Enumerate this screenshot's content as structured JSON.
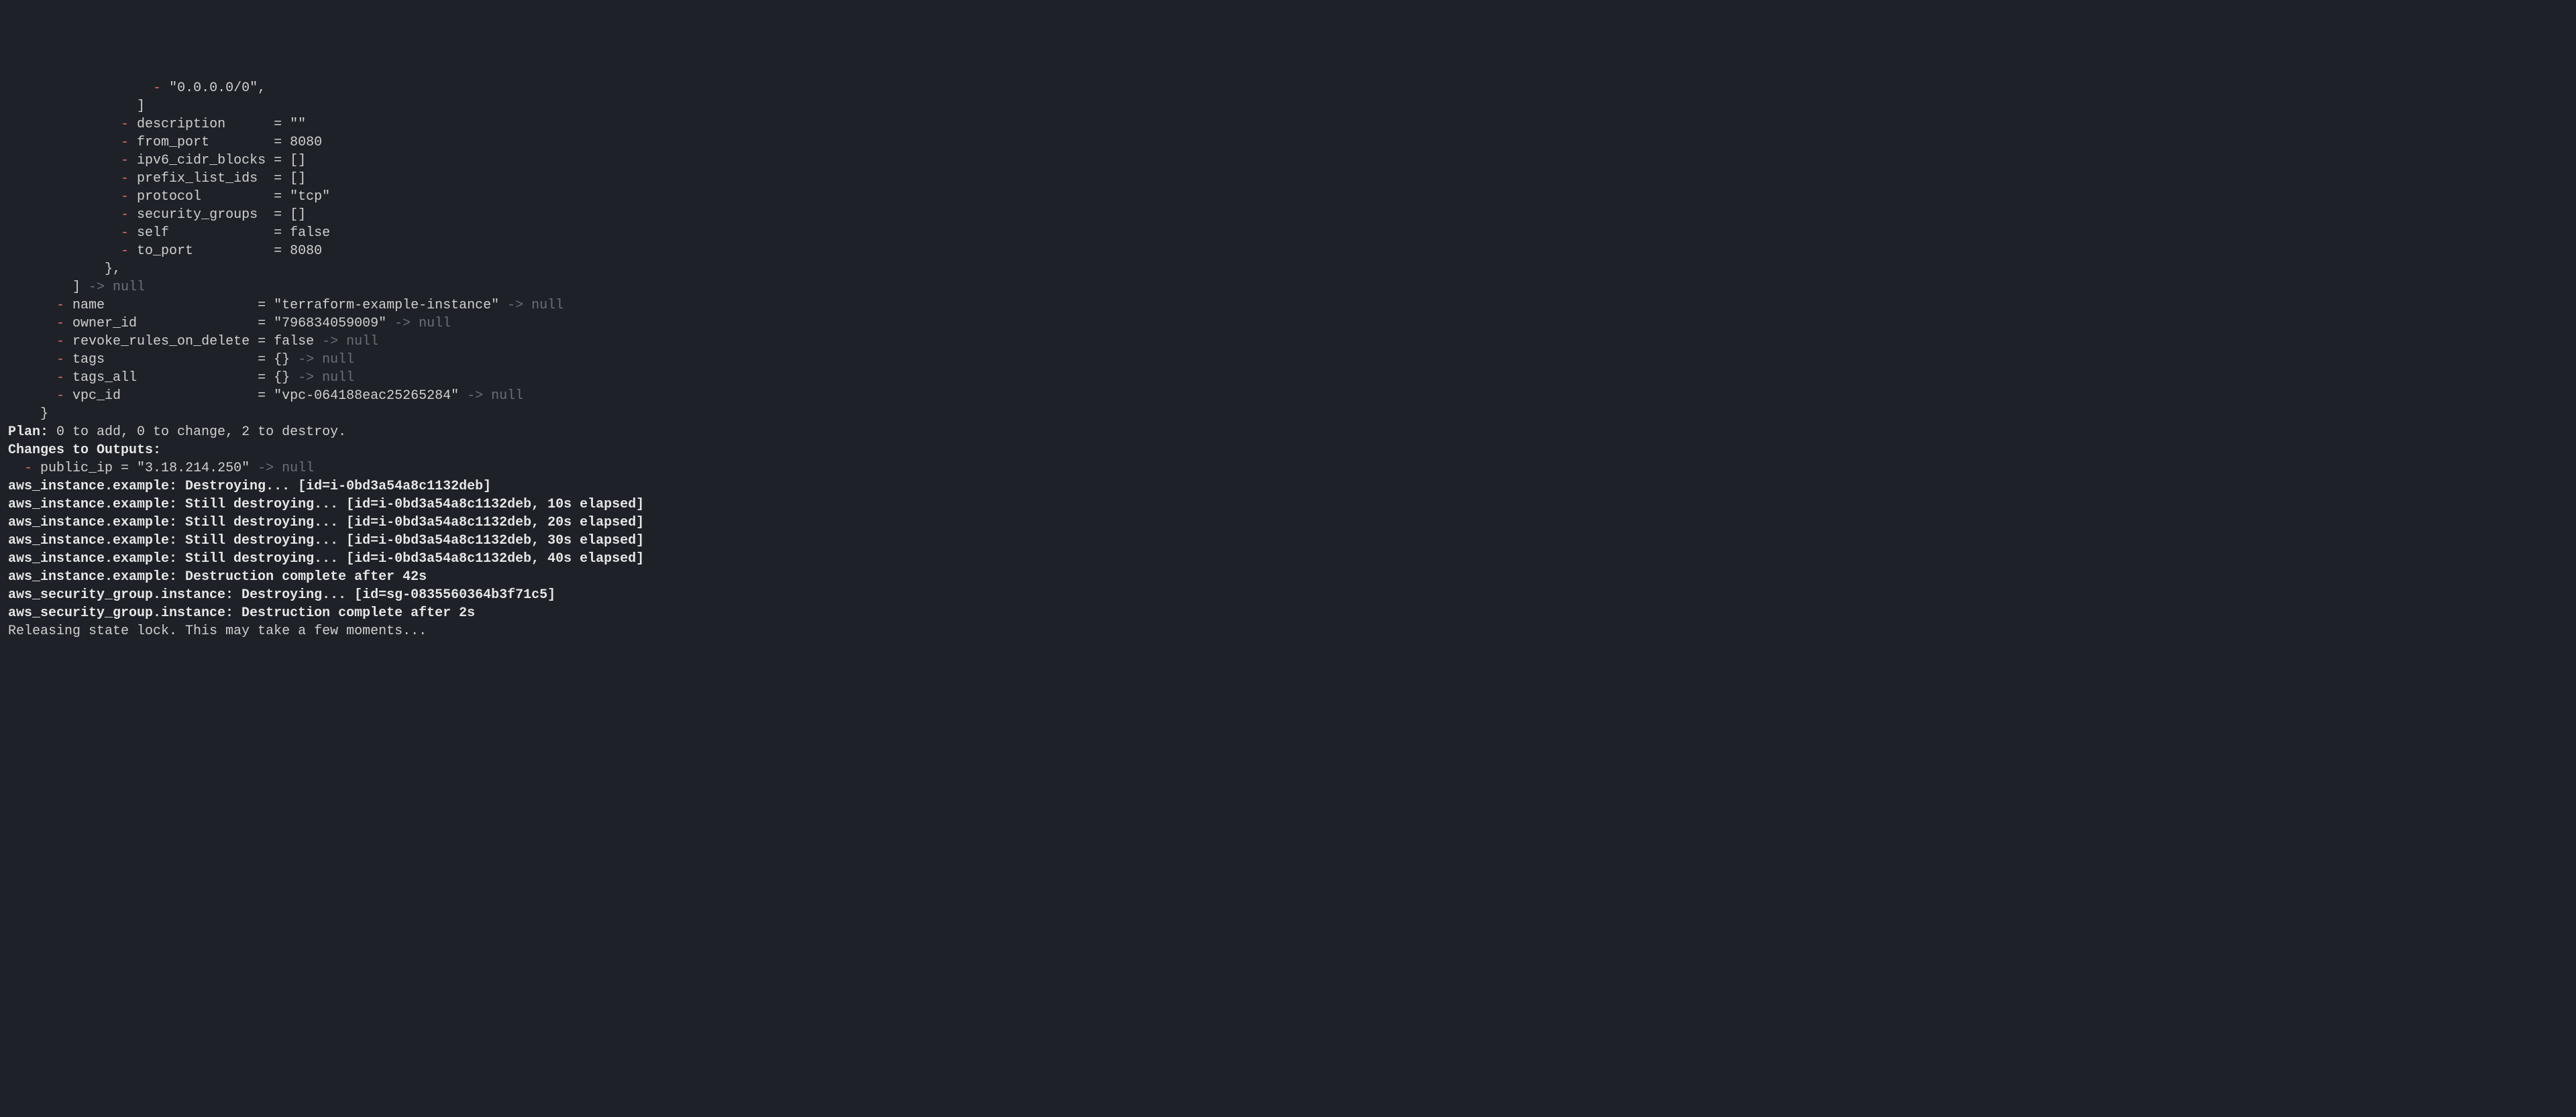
{
  "diff": {
    "marker": "-",
    "cidr_value": "\"0.0.0.0/0\",",
    "close_bracket": "]",
    "attrs": [
      {
        "key": "description",
        "eq": "= ",
        "val": "\"\""
      },
      {
        "key": "from_port",
        "eq": "= ",
        "val": "8080"
      },
      {
        "key": "ipv6_cidr_blocks",
        "eq": "= ",
        "val": "[]"
      },
      {
        "key": "prefix_list_ids",
        "eq": "= ",
        "val": "[]"
      },
      {
        "key": "protocol",
        "eq": "= ",
        "val": "\"tcp\""
      },
      {
        "key": "security_groups",
        "eq": "= ",
        "val": "[]"
      },
      {
        "key": "self",
        "eq": "= ",
        "val": "false"
      },
      {
        "key": "to_port",
        "eq": "= ",
        "val": "8080"
      }
    ],
    "block_close": "},",
    "list_close_prefix": "] ",
    "list_close_arrow": "-> ",
    "list_close_null": "null",
    "outer": [
      {
        "key": "name",
        "val": "\"terraform-example-instance\"",
        "arrow": " -> ",
        "null": "null"
      },
      {
        "key": "owner_id",
        "val": "\"796834059009\"",
        "arrow": " -> ",
        "null": "null"
      },
      {
        "key": "revoke_rules_on_delete",
        "val": "false",
        "arrow": " -> ",
        "null": "null"
      },
      {
        "key": "tags",
        "val": "{}",
        "arrow": " -> ",
        "null": "null"
      },
      {
        "key": "tags_all",
        "val": "{}",
        "arrow": " -> ",
        "null": "null"
      },
      {
        "key": "vpc_id",
        "val": "\"vpc-064188eac25265284\"",
        "arrow": " -> ",
        "null": "null"
      }
    ],
    "final_close": "}"
  },
  "plan": {
    "label": "Plan:",
    "text": " 0 to add, 0 to change, 2 to destroy."
  },
  "changes": {
    "heading": "Changes to Outputs:",
    "marker": "- ",
    "line": "public_ip = \"3.18.214.250\"",
    "arrow": " -> ",
    "null": "null"
  },
  "log": [
    "aws_instance.example: Destroying... [id=i-0bd3a54a8c1132deb]",
    "aws_instance.example: Still destroying... [id=i-0bd3a54a8c1132deb, 10s elapsed]",
    "aws_instance.example: Still destroying... [id=i-0bd3a54a8c1132deb, 20s elapsed]",
    "aws_instance.example: Still destroying... [id=i-0bd3a54a8c1132deb, 30s elapsed]",
    "aws_instance.example: Still destroying... [id=i-0bd3a54a8c1132deb, 40s elapsed]",
    "aws_instance.example: Destruction complete after 42s",
    "aws_security_group.instance: Destroying... [id=sg-0835560364b3f71c5]",
    "aws_security_group.instance: Destruction complete after 2s"
  ],
  "releasing": "Releasing state lock. This may take a few moments...",
  "pad": {
    "inner_key": 17,
    "outer_key": 23,
    "indent_cidr": "                  ",
    "indent_close_bracket": "                ",
    "indent_inner_marker": "              ",
    "indent_block_close": "            ",
    "indent_list_close": "        ",
    "indent_outer_marker": "      ",
    "indent_final_close": "    ",
    "output_indent": "  "
  }
}
